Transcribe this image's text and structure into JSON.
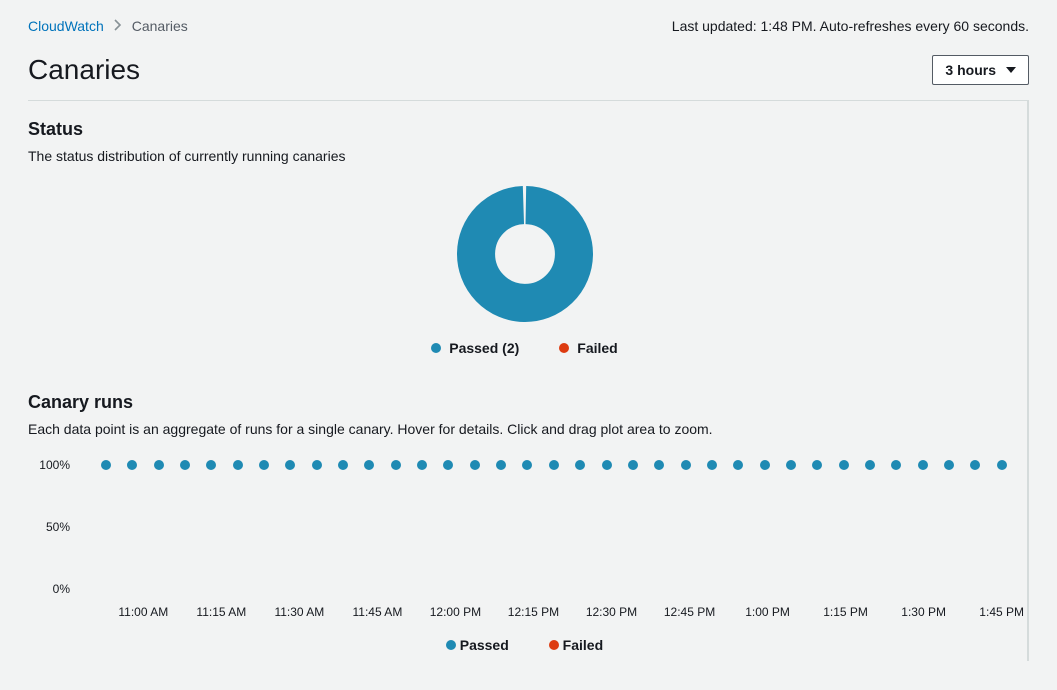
{
  "breadcrumb": {
    "parent": "CloudWatch",
    "current": "Canaries"
  },
  "header": {
    "last_updated": "Last updated: 1:48 PM. Auto-refreshes every 60 seconds.",
    "title": "Canaries",
    "range_selector": "3 hours"
  },
  "status_section": {
    "heading": "Status",
    "description": "The status distribution of currently running canaries",
    "legend_passed": "Passed (2)",
    "legend_failed": "Failed"
  },
  "runs_section": {
    "heading": "Canary runs",
    "description": "Each data point is an aggregate of runs for a single canary. Hover for details. Click and drag plot area to zoom.",
    "legend_passed": "Passed",
    "legend_failed": "Failed"
  },
  "colors": {
    "passed": "#1f8ab3",
    "failed": "#dd3b10"
  },
  "chart_data": [
    {
      "type": "pie",
      "title": "Status",
      "series": [
        {
          "name": "Passed",
          "value": 2
        },
        {
          "name": "Failed",
          "value": 0
        }
      ]
    },
    {
      "type": "scatter",
      "title": "Canary runs",
      "ylabel": "",
      "ylim": [
        0,
        100
      ],
      "yticks": [
        0,
        50,
        100
      ],
      "ytick_labels": [
        "0%",
        "50%",
        "100%"
      ],
      "x_labels": [
        "11:00 AM",
        "11:15 AM",
        "11:30 AM",
        "11:45 AM",
        "12:00 PM",
        "12:15 PM",
        "12:30 PM",
        "12:45 PM",
        "1:00 PM",
        "1:15 PM",
        "1:30 PM",
        "1:45 PM"
      ],
      "series": [
        {
          "name": "Passed",
          "values": [
            100,
            100,
            100,
            100,
            100,
            100,
            100,
            100,
            100,
            100,
            100,
            100,
            100,
            100,
            100,
            100,
            100,
            100,
            100,
            100,
            100,
            100,
            100,
            100,
            100,
            100,
            100,
            100,
            100,
            100,
            100,
            100,
            100,
            100,
            100
          ]
        },
        {
          "name": "Failed",
          "values": []
        }
      ]
    }
  ]
}
